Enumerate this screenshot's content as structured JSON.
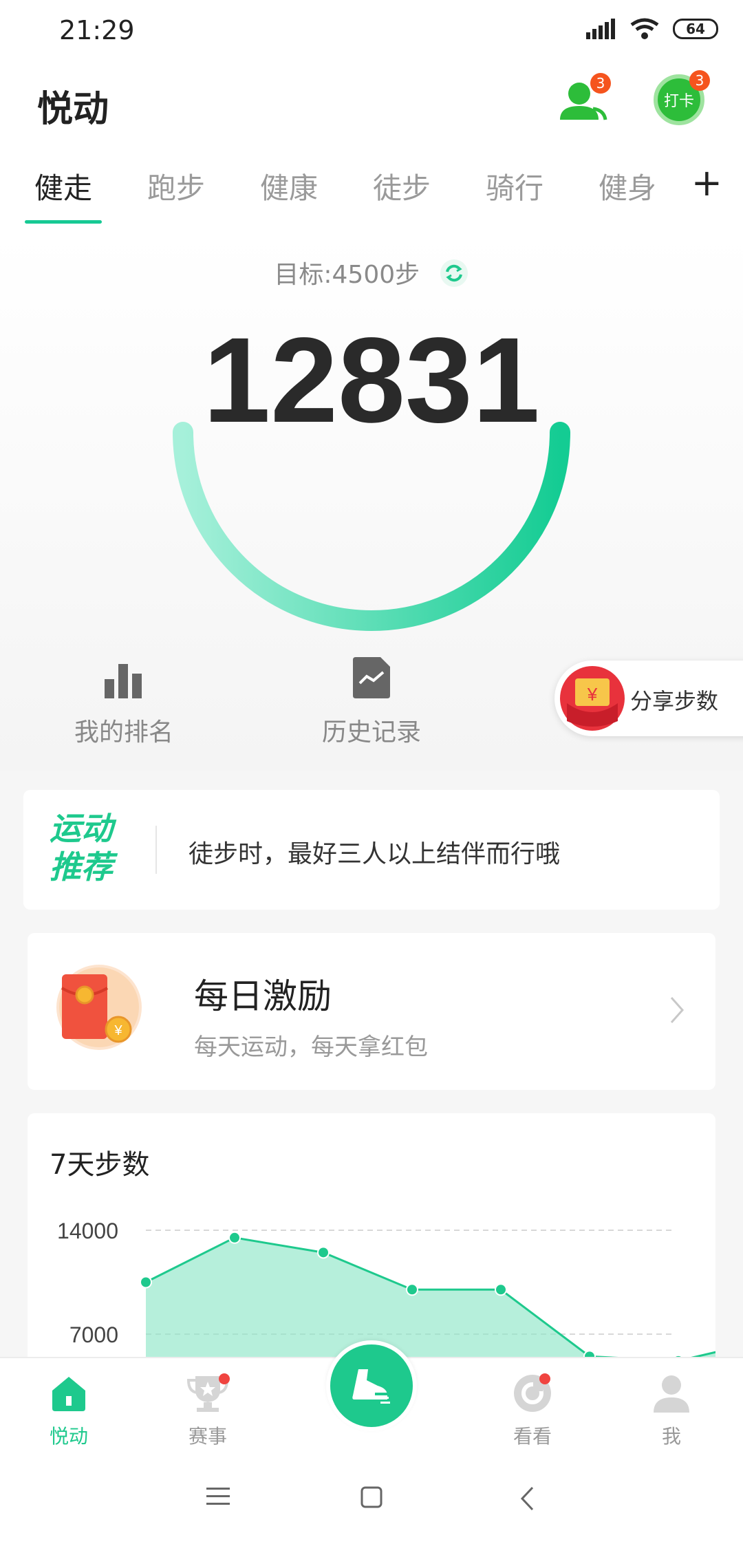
{
  "status_bar": {
    "time": "21:29",
    "battery": "64"
  },
  "header": {
    "title": "悦动",
    "friends_badge": "3",
    "checkin_label": "打卡",
    "checkin_badge": "3"
  },
  "tabs": {
    "items": [
      {
        "label": "健走",
        "active": true
      },
      {
        "label": "跑步",
        "active": false
      },
      {
        "label": "健康",
        "active": false
      },
      {
        "label": "徒步",
        "active": false
      },
      {
        "label": "骑行",
        "active": false
      },
      {
        "label": "健身",
        "active": false
      }
    ],
    "add_label": "+"
  },
  "hero": {
    "goal_text": "目标:4500步",
    "steps": "12831"
  },
  "quick_actions": {
    "ranking_label": "我的排名",
    "history_label": "历史记录"
  },
  "share": {
    "label": "分享步数",
    "currency_symbol": "¥"
  },
  "tip": {
    "tag_line1": "运动",
    "tag_line2": "推荐",
    "text": "徒步时，最好三人以上结伴而行哦"
  },
  "reward": {
    "title": "每日激励",
    "subtitle": "每天运动，每天拿红包"
  },
  "chart": {
    "title": "7天步数",
    "colors": {
      "line": "#1ec98d",
      "fill": "#8fe6c7"
    }
  },
  "chart_data": {
    "type": "area",
    "title": "7天步数",
    "y_ticks": [
      14000,
      7000
    ],
    "ylim": [
      0,
      14000
    ],
    "x": [
      1,
      2,
      3,
      4,
      5,
      6,
      7,
      8
    ],
    "values": [
      10500,
      13500,
      12500,
      10000,
      10000,
      5500,
      5200,
      6600
    ],
    "grid": true
  },
  "bottom_nav": {
    "items": [
      {
        "label": "悦动",
        "active": true
      },
      {
        "label": "赛事",
        "active": false
      },
      {
        "label": "看看",
        "active": false
      },
      {
        "label": "我",
        "active": false
      }
    ]
  },
  "theme": {
    "accent": "#1ec98d",
    "badge": "#f5541e"
  }
}
